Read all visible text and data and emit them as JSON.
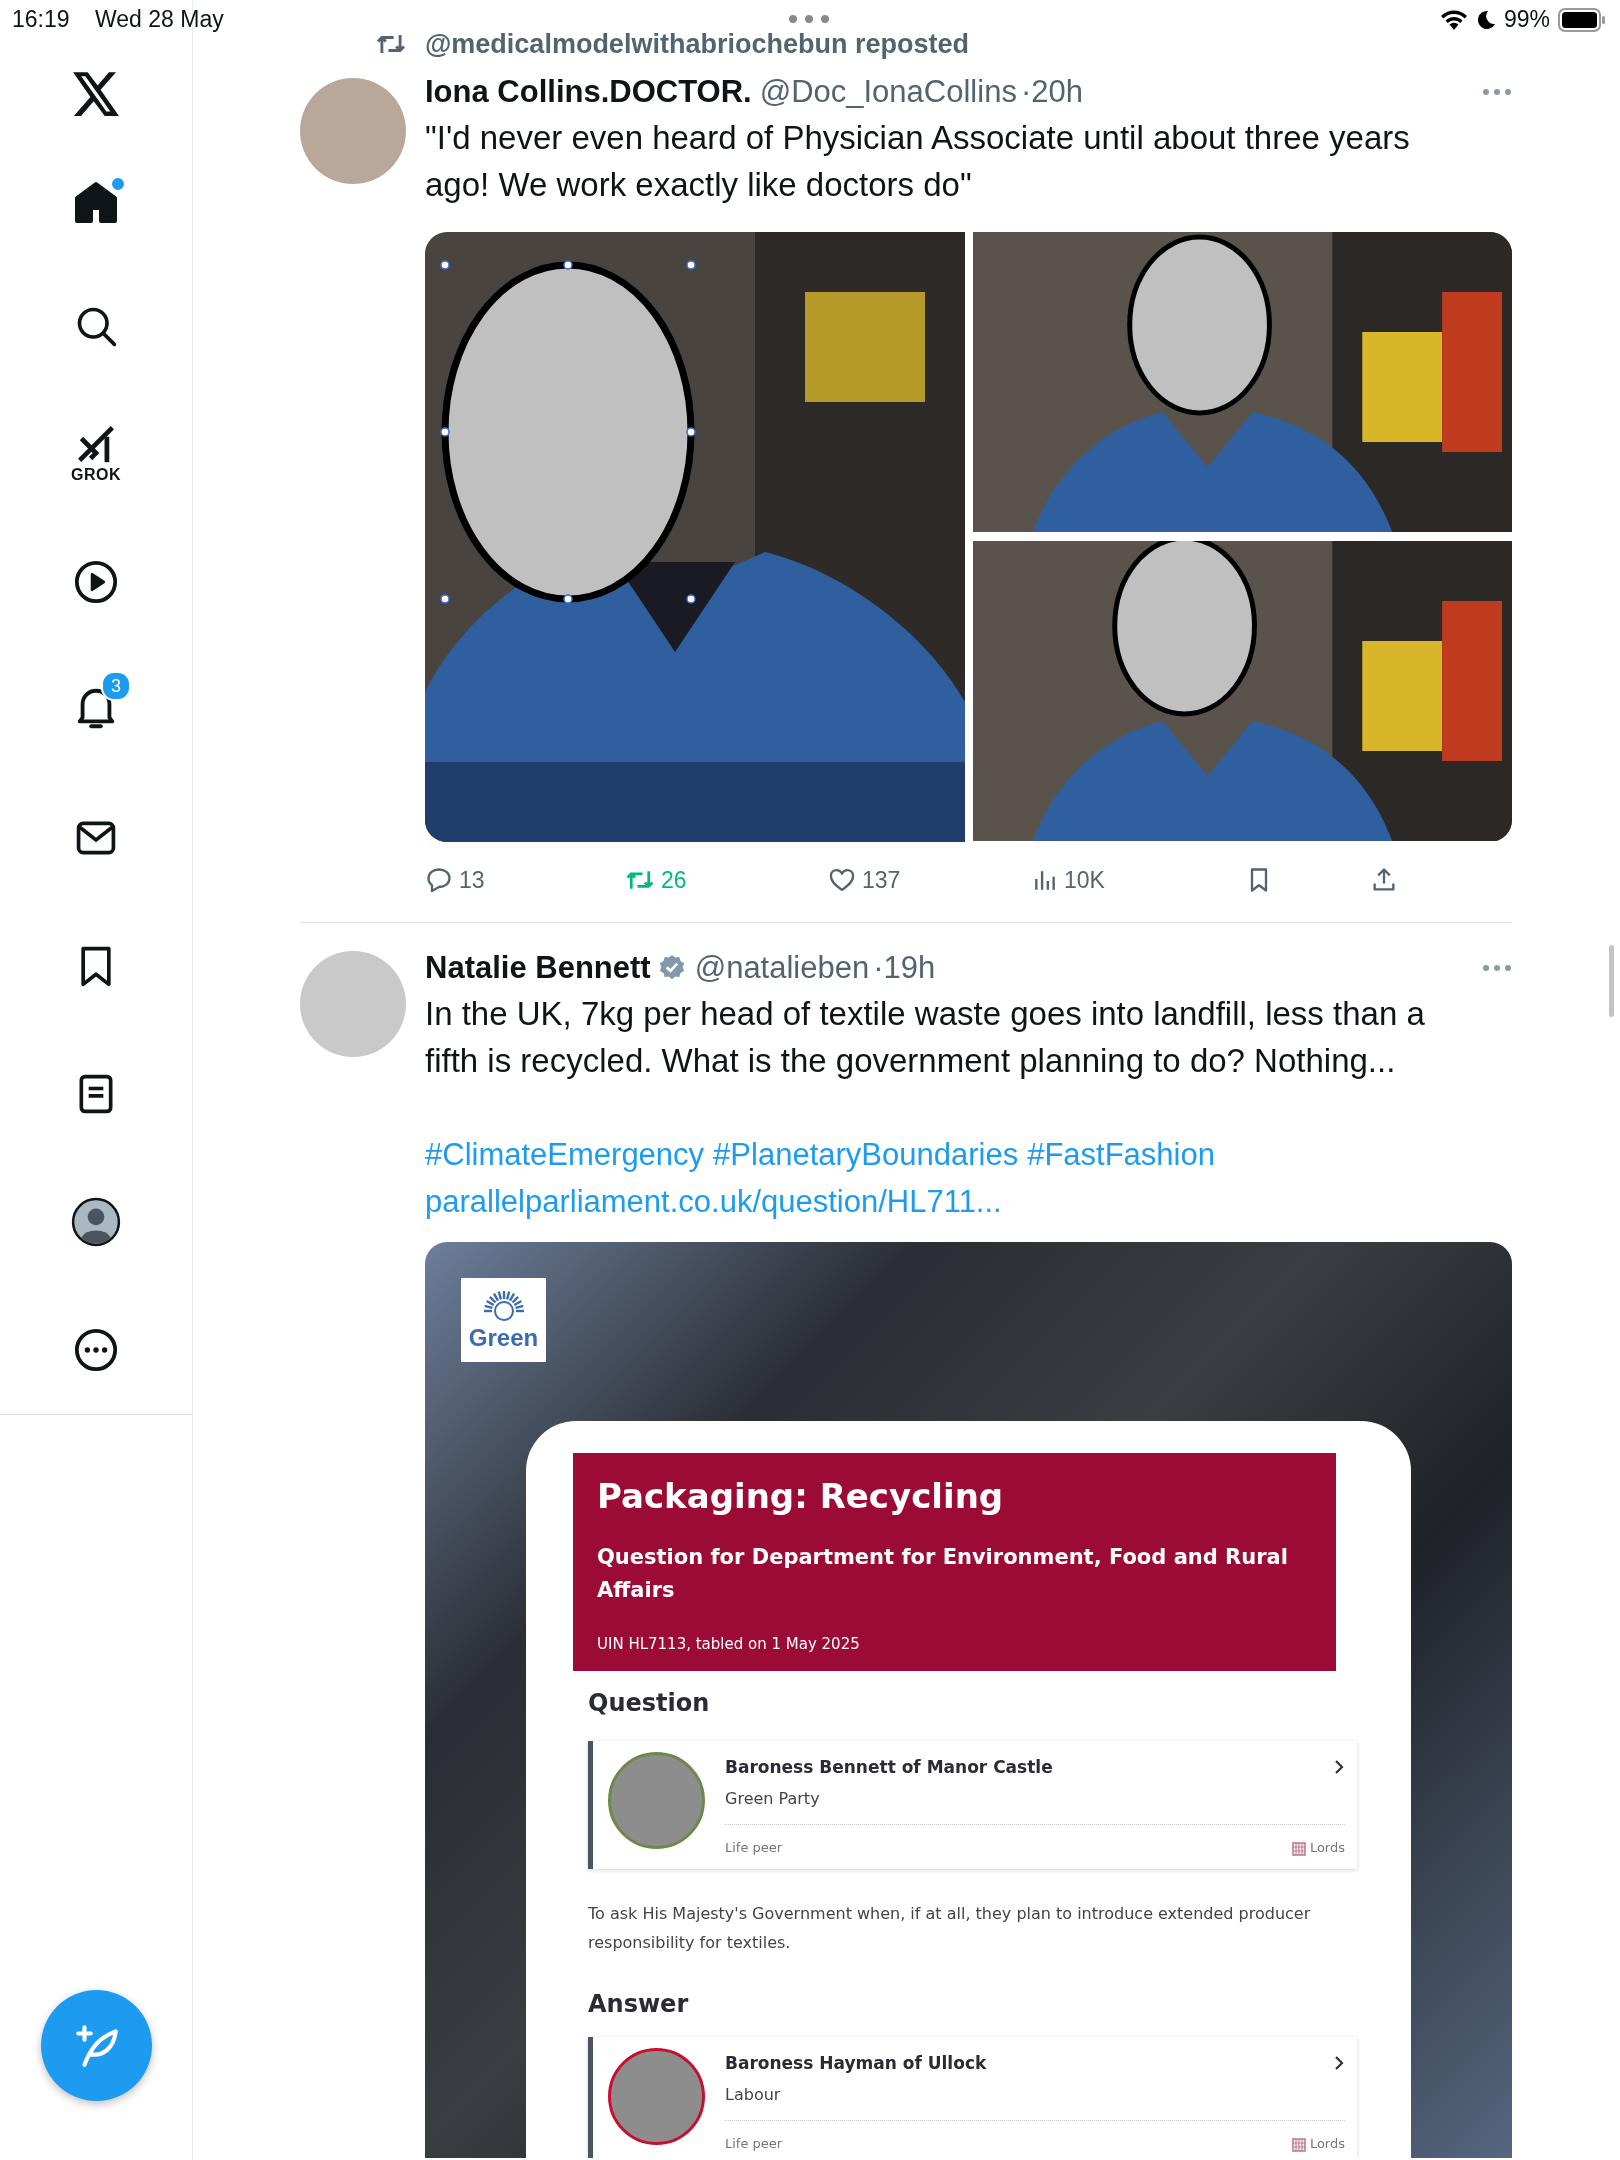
{
  "status_bar": {
    "time": "16:19",
    "date": "Wed 28 May",
    "battery": "99%"
  },
  "sidebar": {
    "items": [
      {
        "kind": "home",
        "selected": true,
        "dot": true
      },
      {
        "kind": "search",
        "selected": false,
        "dot": false
      },
      {
        "kind": "grok",
        "selected": false,
        "dot": false,
        "label": "GROK"
      },
      {
        "kind": "video",
        "selected": false,
        "dot": false
      },
      {
        "kind": "notifications",
        "selected": false,
        "dot": false,
        "badge": "3"
      },
      {
        "kind": "messages",
        "selected": false,
        "dot": false
      },
      {
        "kind": "bookmarks",
        "selected": false,
        "dot": false
      },
      {
        "kind": "lists",
        "selected": false,
        "dot": false
      },
      {
        "kind": "profile",
        "selected": false,
        "dot": false
      },
      {
        "kind": "more",
        "selected": false,
        "dot": false
      }
    ]
  },
  "timeline": {
    "posts": [
      {
        "repost_by": "@medicalmodelwithabriochebun reposted",
        "name": "Iona Collins.DOCTOR.",
        "verified": false,
        "handle": "@Doc_IonaCollins",
        "time": "·20h",
        "text": "\"I'd never even heard of Physician Associate until about three years ago! We work exactly like doctors do\"",
        "media": {
          "kind": "grid"
        },
        "actions": [
          {
            "kind": "reply",
            "count": "13",
            "active": false
          },
          {
            "kind": "repost",
            "count": "26",
            "active": true
          },
          {
            "kind": "like",
            "count": "137",
            "active": false
          },
          {
            "kind": "views",
            "count": "10K",
            "active": false
          },
          {
            "kind": "bookmark",
            "active": false
          },
          {
            "kind": "share",
            "active": false
          }
        ]
      },
      {
        "name": "Natalie Bennett",
        "verified": true,
        "handle": "@natalieben",
        "time": "·19h",
        "text": "In the UK, 7kg per head of textile waste goes into landfill, less than a fifth is recycled. What is the government planning to do? Nothing...",
        "hashtags": [
          "#ClimateEmergency",
          "#PlanetaryBoundaries",
          "#FastFashion"
        ],
        "link": "parallelparliament.co.uk/question/HL711...",
        "media": {
          "kind": "card",
          "logo_text": "Green",
          "title": "Packaging: Recycling",
          "subtitle": "Question for Department for Environment, Food and Rural Affairs",
          "meta": "UIN HL7113, tabled on 1 May 2025",
          "sections": [
            {
              "heading": "Question",
              "member": {
                "name": "Baroness Bennett of Manor Castle",
                "party": "Green Party",
                "role": "Life peer",
                "house": "Lords",
                "color": "#6b8a4a"
              },
              "text": "To ask His Majesty's Government when, if at all, they plan to introduce extended producer responsibility for textiles."
            },
            {
              "heading": "Answer",
              "member": {
                "name": "Baroness Hayman of Ullock",
                "party": "Labour",
                "role": "Life peer",
                "house": "Lords",
                "color": "#c8102e"
              }
            }
          ]
        }
      }
    ]
  }
}
